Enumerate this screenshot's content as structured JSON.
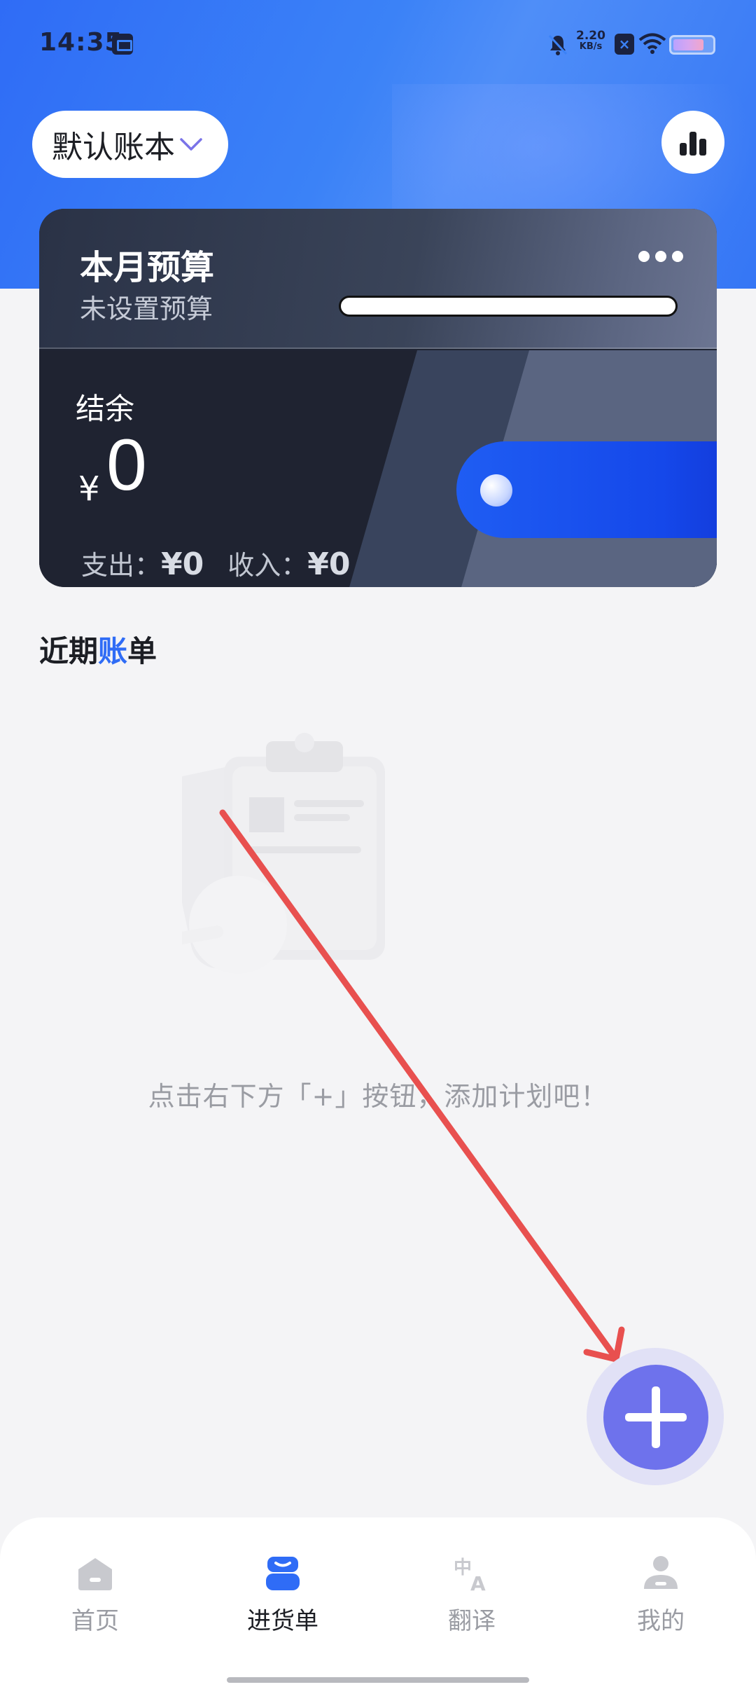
{
  "status_bar": {
    "time": "14:35",
    "network_speed_value": "2.20",
    "network_speed_unit": "KB/s",
    "icons": [
      "app-notification-icon",
      "mute-icon",
      "x-app-icon",
      "wifi-icon",
      "battery-icon"
    ],
    "battery_level": 0.8
  },
  "header": {
    "ledger_name": "默认账本",
    "stats_icon": "bar-chart-icon"
  },
  "budget_card": {
    "title": "本月预算",
    "subtitle": "未设置预算",
    "more_icon": "more-dots-icon",
    "balance_label": "结余",
    "currency_symbol": "¥",
    "balance_value": "0",
    "expense_label": "支出：",
    "expense_value": "¥0",
    "income_label": "收入：",
    "income_value": "¥0"
  },
  "recent": {
    "title_part1": "近期",
    "title_part2": "账",
    "title_part3": "单",
    "empty_hint": "点击右下方「+」按钮，添加计划吧！"
  },
  "fab": {
    "icon": "plus-icon"
  },
  "bottom_nav": {
    "items": [
      {
        "label": "首页",
        "icon": "home-icon",
        "active": false
      },
      {
        "label": "进货单",
        "icon": "purchase-order-icon",
        "active": true
      },
      {
        "label": "翻译",
        "icon": "translate-icon",
        "active": false
      },
      {
        "label": "我的",
        "icon": "profile-icon",
        "active": false
      }
    ]
  },
  "colors": {
    "header_blue": "#2f6cf6",
    "accent_blue": "#2f6cf6",
    "fab_purple": "#6e72ec",
    "card_dark": "#1f2331",
    "annotation_red": "#e8504f"
  }
}
